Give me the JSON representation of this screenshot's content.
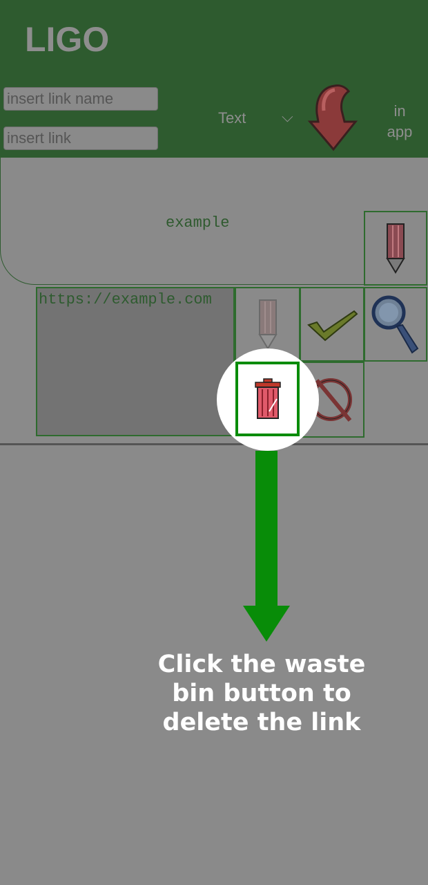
{
  "header": {
    "app_title": "LIGO",
    "link_name_placeholder": "insert link name",
    "link_placeholder": "insert link",
    "type_selected": "Text",
    "in_app_label": "in\napp",
    "icons": {
      "type_dropdown": "chevron-down-icon",
      "add": "down-arrow-icon"
    }
  },
  "item": {
    "name": "example",
    "url": "https://example.com",
    "icons": [
      "pencil-icon",
      "check-icon",
      "magnifier-icon",
      "trash-icon",
      "no-icon"
    ]
  },
  "tutorial": {
    "hint": "Click the waste bin button to delete the link",
    "accent_color": "#088c08"
  }
}
